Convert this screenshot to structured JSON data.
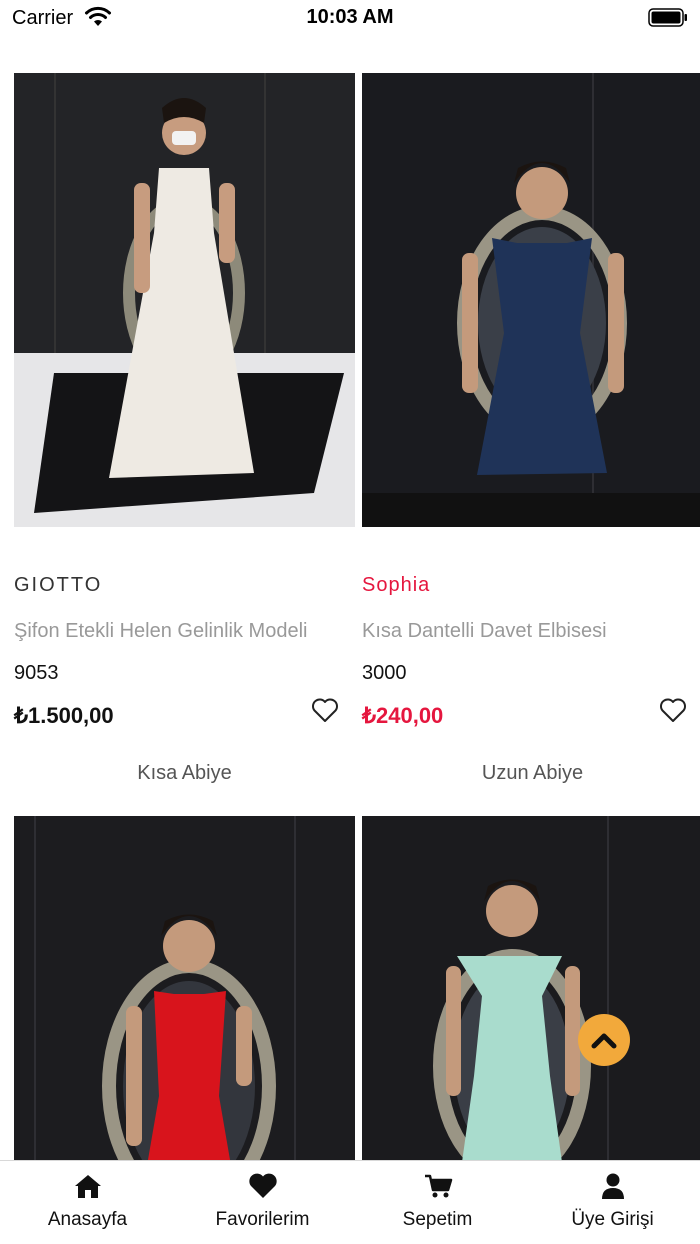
{
  "status_bar": {
    "carrier": "Carrier",
    "time": "10:03 AM"
  },
  "products": [
    {
      "brand": "GIOTTO",
      "name": "Şifon Etekli Helen Gelinlik Modeli",
      "code": "9053",
      "price": "₺1.500,00",
      "category": "Kısa Abiye",
      "dress_color": "#eeeae3"
    },
    {
      "brand": "Sophia",
      "name": "Kısa Dantelli Davet Elbisesi",
      "code": "3000",
      "price": "₺240,00",
      "category": "Uzun Abiye",
      "dress_color": "#1f3358"
    },
    {
      "dress_color": "#d8141c"
    },
    {
      "dress_color": "#a9dccd"
    }
  ],
  "tab_bar": {
    "items": [
      {
        "label": "Anasayfa",
        "icon": "home-icon"
      },
      {
        "label": "Favorilerim",
        "icon": "heart-icon"
      },
      {
        "label": "Sepetim",
        "icon": "cart-icon"
      },
      {
        "label": "Üye Girişi",
        "icon": "user-icon"
      }
    ]
  },
  "colors": {
    "accent": "#e5163e",
    "scroll_top": "#f2a93b",
    "muted_text": "#999999"
  }
}
